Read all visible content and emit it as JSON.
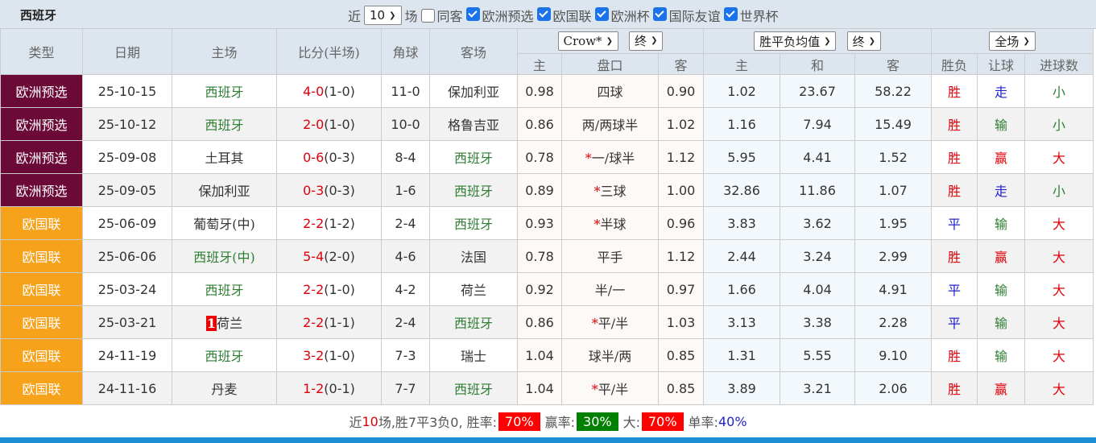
{
  "title": "西班牙",
  "filters": {
    "recent_label": "近",
    "recent_value": "10",
    "games_label": "场",
    "same_venue": {
      "label": "同客",
      "checked": false
    },
    "competitions": [
      {
        "label": "欧洲预选",
        "checked": true
      },
      {
        "label": "欧国联",
        "checked": true
      },
      {
        "label": "欧洲杯",
        "checked": true
      },
      {
        "label": "国际友谊",
        "checked": true
      },
      {
        "label": "世界杯",
        "checked": true
      }
    ]
  },
  "columns": {
    "type": "类型",
    "date": "日期",
    "home": "主场",
    "score": "比分(半场)",
    "corner": "角球",
    "away": "客场",
    "ah_company": "Crow*",
    "ah_stage": "终",
    "eu_company": "胜平负均值",
    "eu_stage": "终",
    "period": "全场",
    "ah": [
      "主",
      "盘口",
      "客"
    ],
    "eu": [
      "主",
      "和",
      "客"
    ],
    "res": [
      "胜负",
      "让球",
      "进球数"
    ]
  },
  "colors": {
    "euro_qual": "#6b0a36",
    "nations_league": "#f7a21b",
    "win": "#e0000a",
    "draw": "#2222cc",
    "loss": "#2e7d32"
  },
  "rows": [
    {
      "type": "欧洲预选",
      "date": "25-10-15",
      "home": "西班牙",
      "home_green": true,
      "rank": "",
      "score": "4-0",
      "half": "(1-0)",
      "corner": "11-0",
      "away": "保加利亚",
      "away_green": false,
      "ah_h": "0.98",
      "line_star": "",
      "line": "四球",
      "ah_a": "0.90",
      "eu_h": "1.02",
      "eu_d": "23.67",
      "eu_a": "58.22",
      "r1": "胜",
      "r2": "走",
      "r3": "小"
    },
    {
      "type": "欧洲预选",
      "date": "25-10-12",
      "home": "西班牙",
      "home_green": true,
      "rank": "",
      "score": "2-0",
      "half": "(1-0)",
      "corner": "10-0",
      "away": "格鲁吉亚",
      "away_green": false,
      "ah_h": "0.86",
      "line_star": "",
      "line": "两/两球半",
      "ah_a": "1.02",
      "eu_h": "1.16",
      "eu_d": "7.94",
      "eu_a": "15.49",
      "r1": "胜",
      "r2": "输",
      "r3": "小"
    },
    {
      "type": "欧洲预选",
      "date": "25-09-08",
      "home": "土耳其",
      "home_green": false,
      "rank": "",
      "score": "0-6",
      "half": "(0-3)",
      "corner": "8-4",
      "away": "西班牙",
      "away_green": true,
      "ah_h": "0.78",
      "line_star": "*",
      "line": "一/球半",
      "ah_a": "1.12",
      "eu_h": "5.95",
      "eu_d": "4.41",
      "eu_a": "1.52",
      "r1": "胜",
      "r2": "赢",
      "r3": "大"
    },
    {
      "type": "欧洲预选",
      "date": "25-09-05",
      "home": "保加利亚",
      "home_green": false,
      "rank": "",
      "score": "0-3",
      "half": "(0-3)",
      "corner": "1-6",
      "away": "西班牙",
      "away_green": true,
      "ah_h": "0.89",
      "line_star": "*",
      "line": "三球",
      "ah_a": "1.00",
      "eu_h": "32.86",
      "eu_d": "11.86",
      "eu_a": "1.07",
      "r1": "胜",
      "r2": "走",
      "r3": "小"
    },
    {
      "type": "欧国联",
      "date": "25-06-09",
      "home": "葡萄牙(中)",
      "home_green": false,
      "rank": "",
      "score": "2-2",
      "half": "(1-2)",
      "corner": "2-4",
      "away": "西班牙",
      "away_green": true,
      "ah_h": "0.93",
      "line_star": "*",
      "line": "半球",
      "ah_a": "0.96",
      "eu_h": "3.83",
      "eu_d": "3.62",
      "eu_a": "1.95",
      "r1": "平",
      "r2": "输",
      "r3": "大"
    },
    {
      "type": "欧国联",
      "date": "25-06-06",
      "home": "西班牙(中)",
      "home_green": true,
      "rank": "",
      "score": "5-4",
      "half": "(2-0)",
      "corner": "4-6",
      "away": "法国",
      "away_green": false,
      "ah_h": "0.78",
      "line_star": "",
      "line": "平手",
      "ah_a": "1.12",
      "eu_h": "2.44",
      "eu_d": "3.24",
      "eu_a": "2.99",
      "r1": "胜",
      "r2": "赢",
      "r3": "大"
    },
    {
      "type": "欧国联",
      "date": "25-03-24",
      "home": "西班牙",
      "home_green": true,
      "rank": "",
      "score": "2-2",
      "half": "(1-0)",
      "corner": "4-2",
      "away": "荷兰",
      "away_green": false,
      "ah_h": "0.92",
      "line_star": "",
      "line": "半/一",
      "ah_a": "0.97",
      "eu_h": "1.66",
      "eu_d": "4.04",
      "eu_a": "4.91",
      "r1": "平",
      "r2": "输",
      "r3": "大"
    },
    {
      "type": "欧国联",
      "date": "25-03-21",
      "home": "荷兰",
      "home_green": false,
      "rank": "1",
      "score": "2-2",
      "half": "(1-1)",
      "corner": "2-4",
      "away": "西班牙",
      "away_green": true,
      "ah_h": "0.86",
      "line_star": "*",
      "line": "平/半",
      "ah_a": "1.03",
      "eu_h": "3.13",
      "eu_d": "3.38",
      "eu_a": "2.28",
      "r1": "平",
      "r2": "输",
      "r3": "大"
    },
    {
      "type": "欧国联",
      "date": "24-11-19",
      "home": "西班牙",
      "home_green": true,
      "rank": "",
      "score": "3-2",
      "half": "(1-0)",
      "corner": "7-3",
      "away": "瑞士",
      "away_green": false,
      "ah_h": "1.04",
      "line_star": "",
      "line": "球半/两",
      "ah_a": "0.85",
      "eu_h": "1.31",
      "eu_d": "5.55",
      "eu_a": "9.10",
      "r1": "胜",
      "r2": "输",
      "r3": "大"
    },
    {
      "type": "欧国联",
      "date": "24-11-16",
      "home": "丹麦",
      "home_green": false,
      "rank": "",
      "score": "1-2",
      "half": "(0-1)",
      "corner": "7-7",
      "away": "西班牙",
      "away_green": true,
      "ah_h": "1.04",
      "line_star": "*",
      "line": "平/半",
      "ah_a": "0.85",
      "eu_h": "3.89",
      "eu_d": "3.21",
      "eu_a": "2.06",
      "r1": "胜",
      "r2": "赢",
      "r3": "大"
    }
  ],
  "summary": {
    "p1": "近",
    "n": "10",
    "p2": "场,胜7平3负0, 胜率:",
    "win_rate": "70%",
    "cover_label": "赢率:",
    "cover_rate": "30%",
    "over_label": "大:",
    "over_rate": "70%",
    "odd_label": "单率:",
    "odd_rate": "40%"
  }
}
